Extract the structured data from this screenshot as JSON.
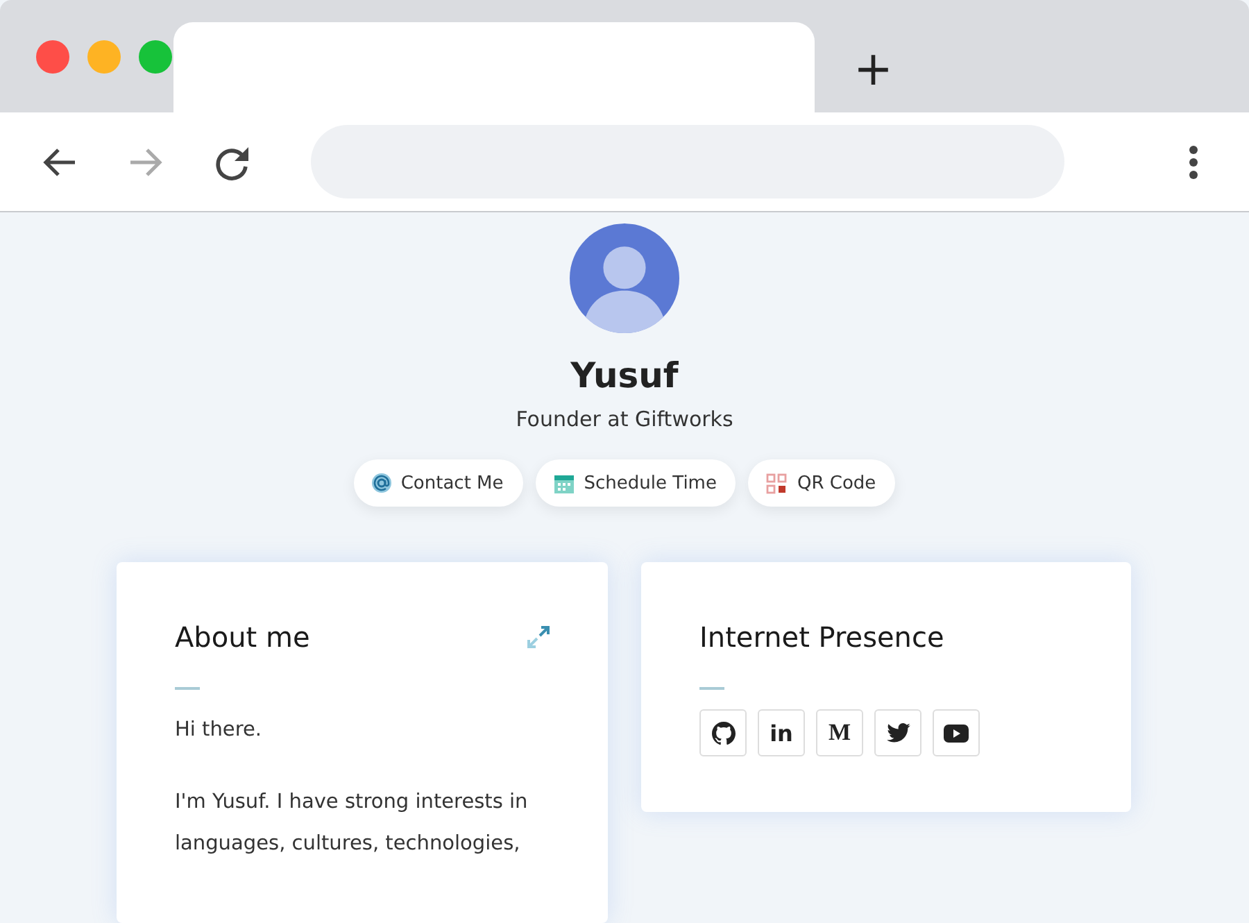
{
  "browser": {
    "new_tab": "+"
  },
  "profile": {
    "name": "Yusuf",
    "subtitle": "Founder at Giftworks"
  },
  "actions": [
    {
      "kind": "contact",
      "label": "Contact Me"
    },
    {
      "kind": "schedule",
      "label": "Schedule Time"
    },
    {
      "kind": "qr",
      "label": "QR Code"
    }
  ],
  "about": {
    "title": "About me",
    "paragraphs": [
      "Hi there.",
      "I'm Yusuf. I have strong interests in languages, cultures, technologies,"
    ]
  },
  "presence": {
    "title": "Internet Presence",
    "links": [
      {
        "kind": "github"
      },
      {
        "kind": "linkedin",
        "label": "in"
      },
      {
        "kind": "medium",
        "label": "M"
      },
      {
        "kind": "twitter"
      },
      {
        "kind": "youtube"
      }
    ]
  }
}
